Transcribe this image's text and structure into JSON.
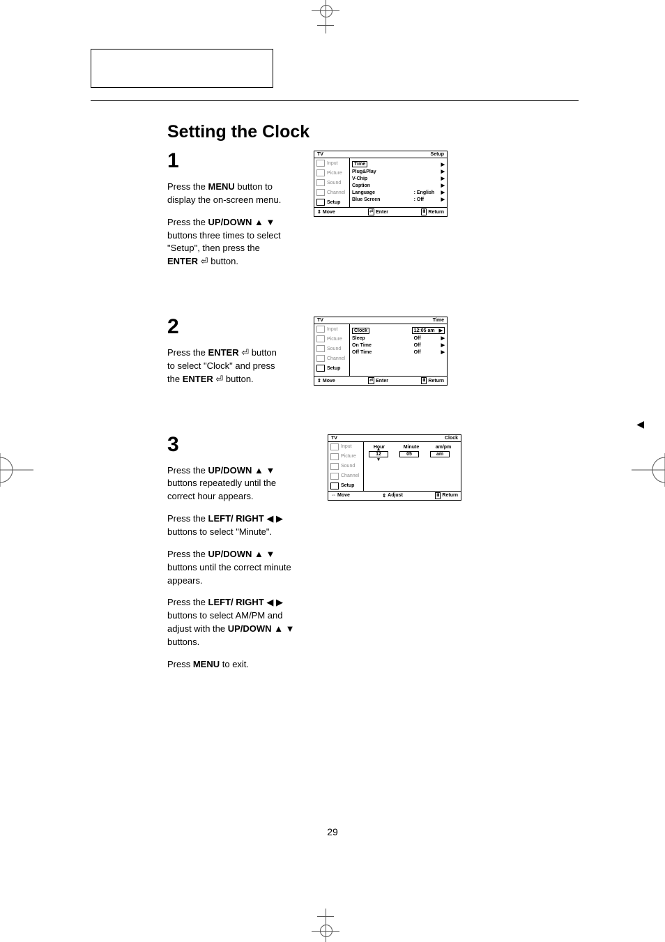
{
  "title": "Setting the Clock",
  "page_number": "29",
  "steps": {
    "s1": {
      "num": "1",
      "p1a": "Press the ",
      "p1b": "MENU",
      "p1c": " button to display the on-screen menu.",
      "p2a": "Press the ",
      "p2b": "UP/DOWN",
      "p2arrows": "▲ ▼",
      "p2c": " buttons three times to select \"Setup\", then press the ",
      "p2d": "ENTER",
      "p2e": " button."
    },
    "s2": {
      "num": "2",
      "p1a": "Press the ",
      "p1b": "ENTER",
      "p1c": " button to select \"Clock\" and press the ",
      "p1d": "ENTER",
      "p1e": " button."
    },
    "s3": {
      "num": "3",
      "p1a": "Press the ",
      "p1b": "UP/DOWN",
      "p1arrows": "▲ ▼",
      "p1c": " buttons repeatedly until the correct hour appears.",
      "p2a": "Press the ",
      "p2b": "LEFT/ RIGHT",
      "p2arrows": "◀ ▶",
      "p2c": " buttons to select \"Minute\".",
      "p3a": "Press the ",
      "p3b": "UP/DOWN",
      "p3arrows": "▲ ▼",
      "p3c": " buttons until the correct minute appears.",
      "p4a": "Press the ",
      "p4b": "LEFT/ RIGHT",
      "p4arrows": "◀ ▶",
      "p4c": " buttons to select AM/PM and adjust with the ",
      "p4d": "UP/DOWN",
      "p4darrows": "▲ ▼",
      "p4e": " buttons.",
      "p5a": "Press ",
      "p5b": "MENU",
      "p5c": " to exit."
    }
  },
  "osd_sidebar": {
    "i0": "Input",
    "i1": "Picture",
    "i2": "Sound",
    "i3": "Channel",
    "i4": "Setup"
  },
  "osd1": {
    "brand": "TV",
    "section": "Setup",
    "r0l": "Time",
    "r1l": "Plug&Play",
    "r2l": "V-Chip",
    "r3l": "Caption",
    "r4l": "Language",
    "r4v": ":  English",
    "r5l": "Blue Screen",
    "r5v": ":  Off",
    "f_move": "Move",
    "f_enter": "Enter",
    "f_return": "Return"
  },
  "osd2": {
    "brand": "TV",
    "section": "Time",
    "r0l": "Clock",
    "r0v": "12:05 am",
    "r1l": "Sleep",
    "r1v": "Off",
    "r2l": "On Time",
    "r2v": "Off",
    "r3l": "Off Time",
    "r3v": "Off",
    "f_move": "Move",
    "f_enter": "Enter",
    "f_return": "Return"
  },
  "osd3": {
    "brand": "TV",
    "section": "Clock",
    "h_hour": "Hour",
    "h_min": "Minute",
    "h_ampm": "am/pm",
    "v_hour": "12",
    "v_min": "05",
    "v_ampm": "am",
    "f_move": "Move",
    "f_adjust": "Adjust",
    "f_return": "Return"
  }
}
